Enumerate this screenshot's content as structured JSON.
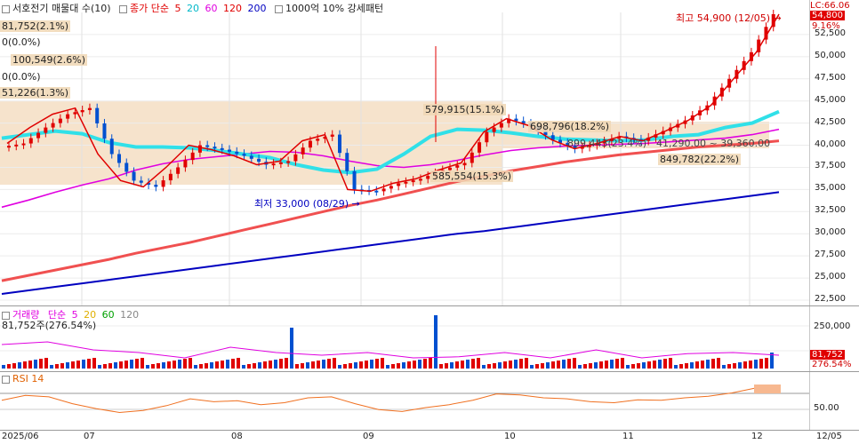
{
  "price_header": {
    "title": "서호전기 매물대 수(10)",
    "ma_label": "종가 단순",
    "ma_periods": [
      "5",
      "20",
      "60",
      "120",
      "200"
    ],
    "ma_colors": [
      "#e00000",
      "#00c8d8",
      "#e000e0",
      "#e00000",
      "#0000c0"
    ],
    "pattern_label": "1000억 10% 강세패턴"
  },
  "price_axis": {
    "ticks": [
      "52,500",
      "50,000",
      "47,500",
      "45,000",
      "42,500",
      "40,000",
      "37,500",
      "35,000",
      "32,500",
      "30,000",
      "27,500",
      "25,000",
      "22,500"
    ],
    "top_label": "LC:66.06",
    "current_price": "54,800",
    "current_change": "9.16%"
  },
  "volume_profile_labels": [
    "81,752(2.1%)",
    "0(0.0%)",
    "100,549(2.6%)",
    "0(0.0%)",
    "51,226(1.3%)",
    "579,915(15.1%)",
    "698,796(18.2%)",
    "899,443(23.4%)",
    "585,554(15.3%)",
    "849,782(22.2%)"
  ],
  "price_annotations": {
    "high": "최고 54,900 (12/05)",
    "low": "최저 33,000 (08/29)",
    "pattern_range": "41,290.00 ~ 39,360.00"
  },
  "volume_header": {
    "title": "거래량",
    "ma_label": "단순",
    "periods": [
      "5",
      "20",
      "60",
      "120"
    ],
    "colors": [
      "#e000e0",
      "#e0c000",
      "#00a000",
      "#888888"
    ],
    "value": "81,752주(276.54%)"
  },
  "volume_axis": {
    "ticks": [
      "250,000",
      "50,000"
    ],
    "current_value": "81,752",
    "current_pct": "276.54%"
  },
  "rsi_header": {
    "title": "RSI 14"
  },
  "rsi_axis": {
    "ticks": [
      "50.00"
    ]
  },
  "date_axis": {
    "labels": [
      "2025/06",
      "07",
      "08",
      "09",
      "10",
      "11",
      "12"
    ],
    "right_label": "12/05"
  },
  "chart_data": {
    "type": "candlestick",
    "title": "서호전기",
    "ylim": [
      22500,
      55000
    ],
    "sma20": [
      40800,
      41200,
      41600,
      41300,
      40300,
      39800,
      39800,
      39700,
      39400,
      39000,
      38600,
      37800,
      37200,
      36900,
      37300,
      39000,
      41000,
      41800,
      41700,
      41400,
      41000,
      40700,
      40600,
      40500,
      40600,
      41000,
      41200,
      42000,
      42500,
      43800
    ],
    "sma60": [
      33000,
      33800,
      34700,
      35500,
      36200,
      37200,
      37900,
      38400,
      38700,
      39000,
      39300,
      39200,
      38800,
      38200,
      37700,
      37500,
      37800,
      38300,
      38900,
      39400,
      39700,
      39900,
      40000,
      40100,
      40200,
      40400,
      40600,
      40800,
      41200,
      41800
    ],
    "sma120": [
      24700,
      25300,
      25900,
      26500,
      27100,
      27800,
      28400,
      29000,
      29700,
      30400,
      31100,
      31800,
      32500,
      33200,
      33800,
      34500,
      35200,
      35900,
      36500,
      37100,
      37600,
      38100,
      38500,
      38900,
      39200,
      39500,
      39800,
      40000,
      40200,
      40500
    ],
    "sma200": [
      23200,
      23600,
      24000,
      24400,
      24800,
      25200,
      25600,
      26000,
      26400,
      26800,
      27200,
      27600,
      28000,
      28400,
      28800,
      29200,
      29600,
      30000,
      30300,
      30700,
      31100,
      31500,
      31900,
      32300,
      32700,
      33100,
      33500,
      33900,
      34300,
      34700
    ],
    "close": [
      40200,
      42000,
      43500,
      44200,
      39000,
      36000,
      35300,
      37500,
      40000,
      39500,
      38800,
      37800,
      38200,
      40500,
      41200,
      35000,
      34800,
      35700,
      36200,
      37200,
      38000,
      41500,
      43000,
      42200,
      40600,
      39600,
      40200,
      41000,
      40500,
      41600,
      42800,
      44500,
      47500,
      50500,
      54800
    ],
    "volume_ma5_series": [
      0.45,
      0.5,
      0.35,
      0.3,
      0.2,
      0.4,
      0.3,
      0.25,
      0.3,
      0.2,
      0.22,
      0.3,
      0.2,
      0.35,
      0.2,
      0.28,
      0.3,
      0.25
    ],
    "rsi": [
      55,
      65,
      62,
      48,
      38,
      30,
      34,
      44,
      58,
      52,
      54,
      46,
      50,
      60,
      62,
      48,
      36,
      32,
      40,
      46,
      55,
      68,
      66,
      60,
      58,
      52,
      50,
      56,
      55,
      60,
      63,
      70,
      80,
      85
    ]
  }
}
